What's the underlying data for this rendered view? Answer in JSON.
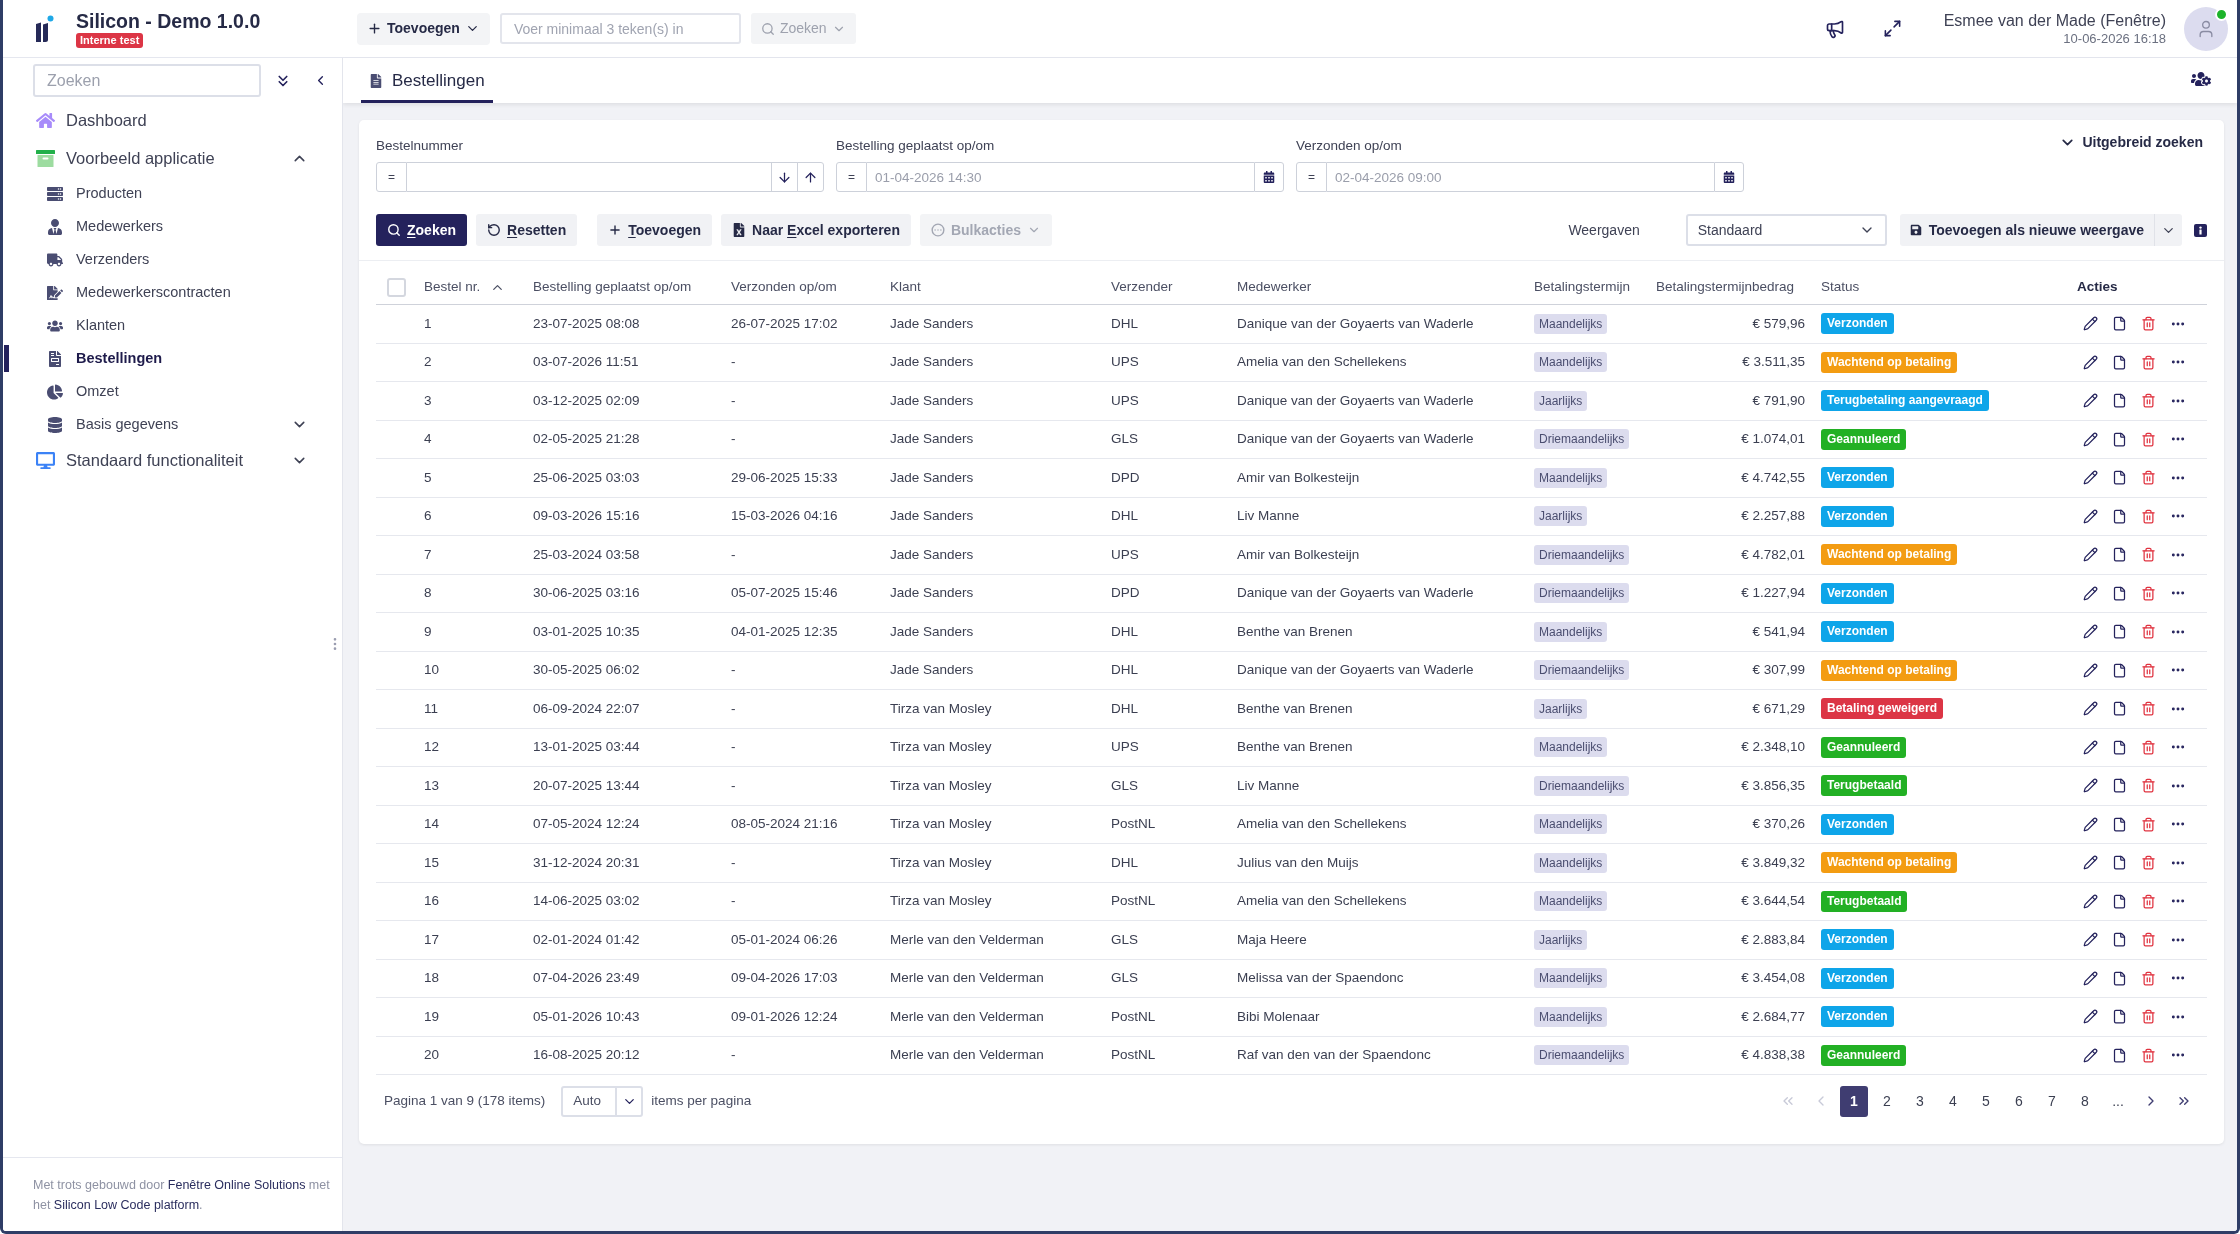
{
  "app": {
    "title": "Silicon - Demo 1.0.0",
    "badge": "Interne test"
  },
  "toolbar": {
    "add_button": "Toevoegen",
    "search": {
      "placeholder": "Voer minimaal 3 teken(s) in"
    },
    "search_button": {
      "label": "Zoeken",
      "disabled": true
    }
  },
  "user": {
    "name": "Esmee van der Made (Fenêtre)",
    "datetime": "10-06-2026 16:18",
    "online": true
  },
  "sidebar": {
    "search": {
      "placeholder": "Zoeken"
    },
    "items": [
      {
        "label": "Dashboard",
        "selected": false
      },
      {
        "label": "Voorbeeld applicatie",
        "selected": false,
        "expanded": true,
        "children": [
          {
            "label": "Producten",
            "selected": false
          },
          {
            "label": "Medewerkers",
            "selected": false
          },
          {
            "label": "Verzenders",
            "selected": false
          },
          {
            "label": "Medewerkerscontracten",
            "selected": false
          },
          {
            "label": "Klanten",
            "selected": false
          },
          {
            "label": "Bestellingen",
            "selected": true
          },
          {
            "label": "Omzet",
            "selected": false
          },
          {
            "label": "Basis gegevens",
            "selected": false,
            "expanded": false
          }
        ]
      },
      {
        "label": "Standaard functionaliteit",
        "selected": false,
        "expanded": false
      }
    ],
    "footer": [
      {
        "kind": "text",
        "text": "Met trots gebouwd door "
      },
      {
        "kind": "link",
        "text": "Fenêtre Online Solutions"
      },
      {
        "kind": "text",
        "text": " met het "
      },
      {
        "kind": "link",
        "text": "Silicon Low Code platform"
      },
      {
        "kind": "text",
        "text": "."
      }
    ]
  },
  "tabs": [
    {
      "label": "Bestellingen",
      "selected": true
    }
  ],
  "filters": {
    "fields": [
      {
        "kind": "number",
        "label": "Bestelnummer",
        "operator": "="
      },
      {
        "kind": "date",
        "label": "Bestelling geplaatst op/om",
        "operator": "=",
        "placeholder": "01-04-2026 14:30"
      },
      {
        "kind": "date",
        "label": "Verzonden op/om",
        "operator": "=",
        "placeholder": "02-04-2026 09:00"
      }
    ],
    "advanced": {
      "label": "Uitgebreid zoeken",
      "expanded": false
    }
  },
  "actions": [
    {
      "kind": "search",
      "label": [
        {
          "text": "Z",
          "access_key": true
        },
        {
          "text": "oeken",
          "access_key": false
        }
      ],
      "disabled": false
    },
    {
      "kind": "reset",
      "label": [
        {
          "text": "R",
          "access_key": true
        },
        {
          "text": "esetten",
          "access_key": false
        }
      ],
      "disabled": false
    },
    {
      "kind": "add",
      "label": [
        {
          "text": "T",
          "access_key": true
        },
        {
          "text": "oevoegen",
          "access_key": false
        }
      ],
      "disabled": false
    },
    {
      "kind": "export",
      "label": [
        {
          "text": "Naar ",
          "access_key": false
        },
        {
          "text": "E",
          "access_key": true
        },
        {
          "text": "xcel exporteren",
          "access_key": false
        }
      ],
      "disabled": false
    },
    {
      "kind": "bulk",
      "label": [
        {
          "text": "Bulkacties",
          "access_key": false
        }
      ],
      "disabled": true
    }
  ],
  "views": {
    "label": "Weergaven",
    "value": "Standaard",
    "save_button": "Toevoegen als nieuwe weergave"
  },
  "table": {
    "select_all": {
      "checked": false
    },
    "columns": [
      {
        "label": "Bestel nr.",
        "sorted": true,
        "ascending": true
      },
      {
        "label": "Bestelling geplaatst op/om"
      },
      {
        "label": "Verzonden op/om"
      },
      {
        "label": "Klant"
      },
      {
        "label": "Verzender"
      },
      {
        "label": "Medewerker"
      },
      {
        "label": "Betalingstermijn"
      },
      {
        "label": "Betalingstermijnbedrag"
      },
      {
        "label": "Status"
      },
      {
        "label": "Acties"
      }
    ],
    "rows": [
      {
        "number": "1",
        "placed": "23-07-2025 08:08",
        "shipped": "26-07-2025 17:02",
        "customer": "Jade Sanders",
        "carrier": "DHL",
        "employee": "Danique van der Goyaerts van Waderle",
        "term": "Maandelijks",
        "amount": "€ 579,96",
        "status": {
          "label": "Verzonden",
          "color": "#0ea5e9"
        }
      },
      {
        "number": "2",
        "placed": "03-07-2026 11:51",
        "shipped": "-",
        "customer": "Jade Sanders",
        "carrier": "UPS",
        "employee": "Amelia van den Schellekens",
        "term": "Maandelijks",
        "amount": "€ 3.511,35",
        "status": {
          "label": "Wachtend op betaling",
          "color": "#f39c12"
        }
      },
      {
        "number": "3",
        "placed": "03-12-2025 02:09",
        "shipped": "-",
        "customer": "Jade Sanders",
        "carrier": "UPS",
        "employee": "Danique van der Goyaerts van Waderle",
        "term": "Jaarlijks",
        "amount": "€ 791,90",
        "status": {
          "label": "Terugbetaling aangevraagd",
          "color": "#0ea5e9"
        }
      },
      {
        "number": "4",
        "placed": "02-05-2025 21:28",
        "shipped": "-",
        "customer": "Jade Sanders",
        "carrier": "GLS",
        "employee": "Danique van der Goyaerts van Waderle",
        "term": "Driemaandelijks",
        "amount": "€ 1.074,01",
        "status": {
          "label": "Geannuleerd",
          "color": "#22b024"
        }
      },
      {
        "number": "5",
        "placed": "25-06-2025 03:03",
        "shipped": "29-06-2025 15:33",
        "customer": "Jade Sanders",
        "carrier": "DPD",
        "employee": "Amir van Bolkesteijn",
        "term": "Maandelijks",
        "amount": "€ 4.742,55",
        "status": {
          "label": "Verzonden",
          "color": "#0ea5e9"
        }
      },
      {
        "number": "6",
        "placed": "09-03-2026 15:16",
        "shipped": "15-03-2026 04:16",
        "customer": "Jade Sanders",
        "carrier": "DHL",
        "employee": "Liv Manne",
        "term": "Jaarlijks",
        "amount": "€ 2.257,88",
        "status": {
          "label": "Verzonden",
          "color": "#0ea5e9"
        }
      },
      {
        "number": "7",
        "placed": "25-03-2024 03:58",
        "shipped": "-",
        "customer": "Jade Sanders",
        "carrier": "UPS",
        "employee": "Amir van Bolkesteijn",
        "term": "Driemaandelijks",
        "amount": "€ 4.782,01",
        "status": {
          "label": "Wachtend op betaling",
          "color": "#f39c12"
        }
      },
      {
        "number": "8",
        "placed": "30-06-2025 03:16",
        "shipped": "05-07-2025 15:46",
        "customer": "Jade Sanders",
        "carrier": "DPD",
        "employee": "Danique van der Goyaerts van Waderle",
        "term": "Driemaandelijks",
        "amount": "€ 1.227,94",
        "status": {
          "label": "Verzonden",
          "color": "#0ea5e9"
        }
      },
      {
        "number": "9",
        "placed": "03-01-2025 10:35",
        "shipped": "04-01-2025 12:35",
        "customer": "Jade Sanders",
        "carrier": "DHL",
        "employee": "Benthe van Brenen",
        "term": "Maandelijks",
        "amount": "€ 541,94",
        "status": {
          "label": "Verzonden",
          "color": "#0ea5e9"
        }
      },
      {
        "number": "10",
        "placed": "30-05-2025 06:02",
        "shipped": "-",
        "customer": "Jade Sanders",
        "carrier": "DHL",
        "employee": "Danique van der Goyaerts van Waderle",
        "term": "Driemaandelijks",
        "amount": "€ 307,99",
        "status": {
          "label": "Wachtend op betaling",
          "color": "#f39c12"
        }
      },
      {
        "number": "11",
        "placed": "06-09-2024 22:07",
        "shipped": "-",
        "customer": "Tirza van Mosley",
        "carrier": "DHL",
        "employee": "Benthe van Brenen",
        "term": "Jaarlijks",
        "amount": "€ 671,29",
        "status": {
          "label": "Betaling geweigerd",
          "color": "#dc3545"
        }
      },
      {
        "number": "12",
        "placed": "13-01-2025 03:44",
        "shipped": "-",
        "customer": "Tirza van Mosley",
        "carrier": "UPS",
        "employee": "Benthe van Brenen",
        "term": "Maandelijks",
        "amount": "€ 2.348,10",
        "status": {
          "label": "Geannuleerd",
          "color": "#22b024"
        }
      },
      {
        "number": "13",
        "placed": "20-07-2025 13:44",
        "shipped": "-",
        "customer": "Tirza van Mosley",
        "carrier": "GLS",
        "employee": "Liv Manne",
        "term": "Driemaandelijks",
        "amount": "€ 3.856,35",
        "status": {
          "label": "Terugbetaald",
          "color": "#22b024"
        }
      },
      {
        "number": "14",
        "placed": "07-05-2024 12:24",
        "shipped": "08-05-2024 21:16",
        "customer": "Tirza van Mosley",
        "carrier": "PostNL",
        "employee": "Amelia van den Schellekens",
        "term": "Maandelijks",
        "amount": "€ 370,26",
        "status": {
          "label": "Verzonden",
          "color": "#0ea5e9"
        }
      },
      {
        "number": "15",
        "placed": "31-12-2024 20:31",
        "shipped": "-",
        "customer": "Tirza van Mosley",
        "carrier": "DHL",
        "employee": "Julius van den Muijs",
        "term": "Maandelijks",
        "amount": "€ 3.849,32",
        "status": {
          "label": "Wachtend op betaling",
          "color": "#f39c12"
        }
      },
      {
        "number": "16",
        "placed": "14-06-2025 03:02",
        "shipped": "-",
        "customer": "Tirza van Mosley",
        "carrier": "PostNL",
        "employee": "Amelia van den Schellekens",
        "term": "Maandelijks",
        "amount": "€ 3.644,54",
        "status": {
          "label": "Terugbetaald",
          "color": "#22b024"
        }
      },
      {
        "number": "17",
        "placed": "02-01-2024 01:42",
        "shipped": "05-01-2024 06:26",
        "customer": "Merle van den Velderman",
        "carrier": "GLS",
        "employee": "Maja Heere",
        "term": "Jaarlijks",
        "amount": "€ 2.883,84",
        "status": {
          "label": "Verzonden",
          "color": "#0ea5e9"
        }
      },
      {
        "number": "18",
        "placed": "07-04-2026 23:49",
        "shipped": "09-04-2026 17:03",
        "customer": "Merle van den Velderman",
        "carrier": "GLS",
        "employee": "Melissa van der Spaendonc",
        "term": "Maandelijks",
        "amount": "€ 3.454,08",
        "status": {
          "label": "Verzonden",
          "color": "#0ea5e9"
        }
      },
      {
        "number": "19",
        "placed": "05-01-2026 10:43",
        "shipped": "09-01-2026 12:24",
        "customer": "Merle van den Velderman",
        "carrier": "PostNL",
        "employee": "Bibi Molenaar",
        "term": "Maandelijks",
        "amount": "€ 2.684,77",
        "status": {
          "label": "Verzonden",
          "color": "#0ea5e9"
        }
      },
      {
        "number": "20",
        "placed": "16-08-2025 20:12",
        "shipped": "-",
        "customer": "Merle van den Velderman",
        "carrier": "PostNL",
        "employee": "Raf van den van der Spaendonc",
        "term": "Driemaandelijks",
        "amount": "€ 4.838,38",
        "status": {
          "label": "Geannuleerd",
          "color": "#22b024"
        }
      }
    ]
  },
  "pagination": {
    "summary": "Pagina 1 van 9 (178 items)",
    "page_size": "Auto",
    "page_size_label": "items per pagina",
    "first": {
      "disabled": true
    },
    "previous": {
      "disabled": true
    },
    "pages": [
      {
        "label": "1",
        "selected": true
      },
      {
        "label": "2",
        "selected": false
      },
      {
        "label": "3",
        "selected": false
      },
      {
        "label": "4",
        "selected": false
      },
      {
        "label": "5",
        "selected": false
      },
      {
        "label": "6",
        "selected": false
      },
      {
        "label": "7",
        "selected": false
      },
      {
        "label": "8",
        "selected": false
      },
      {
        "label": "...",
        "selected": false
      }
    ],
    "next": {
      "disabled": false
    },
    "last": {
      "disabled": false
    }
  }
}
